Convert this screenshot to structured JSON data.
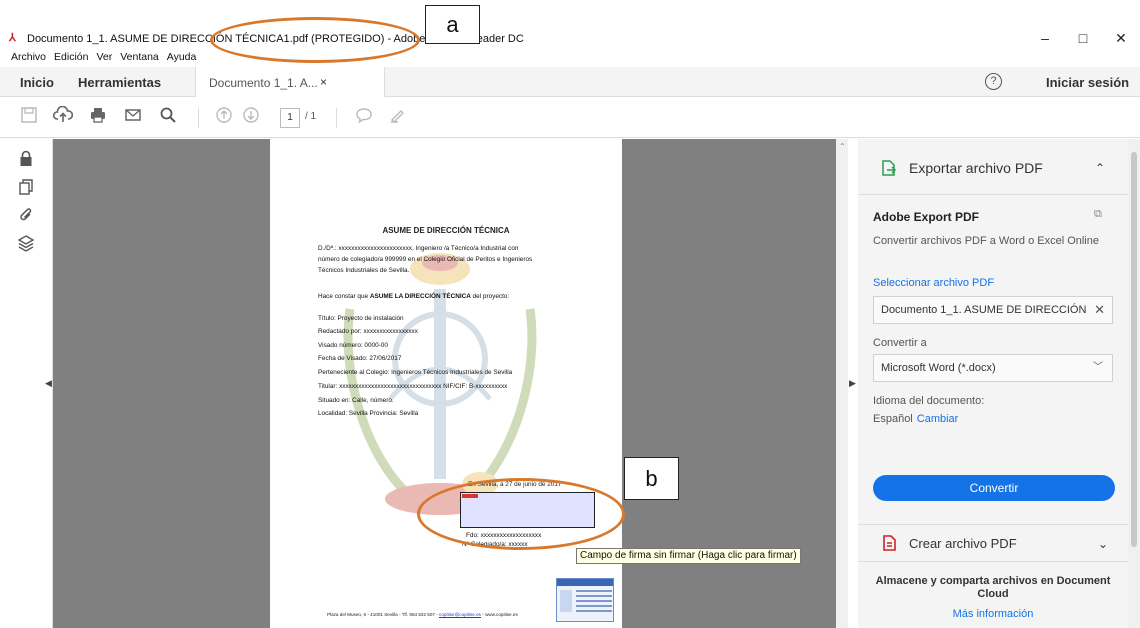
{
  "window": {
    "title": "Documento 1_1. ASUME DE DIRECCIÓN TÉCNICA1.pdf (PROTEGIDO) - Adobe Acrobat Reader DC",
    "controls": [
      "–",
      "□",
      "✕"
    ]
  },
  "menubar": [
    "Archivo",
    "Edición",
    "Ver",
    "Ventana",
    "Ayuda"
  ],
  "tabs": {
    "home": "Inicio",
    "tools": "Herramientas",
    "document": "Documento 1_1. A...",
    "close": "×",
    "help": "?",
    "login": "Iniciar sesión"
  },
  "toolbar": {
    "page_current": "1",
    "page_total": "/ 1"
  },
  "document": {
    "title": "ASUME DE DIRECCIÓN TÉCNICA",
    "paragraph1": [
      "D./Dª.: xxxxxxxxxxxxxxxxxxxxxxx, Ingeniero /a Técnico/a Industrial con",
      "número de colegiado/a 999999 en el Colegio Oficial de Peritos e Ingenieros",
      "Técnicos Industriales de Sevilla."
    ],
    "declaration_prefix": "Hace constar que ",
    "declaration_bold": "ASUME LA DIRECCIÓN TÉCNICA",
    "declaration_suffix": " del proyecto:",
    "fields": [
      "Título: Proyecto de instalación",
      "Redactado por: xxxxxxxxxxxxxxxxx",
      "Visado número: 0000-00",
      "Fecha de Visado: 27/06/2017",
      "Perteneciente al Colegio: Ingenieros Técnicos Industriales de Sevilla",
      "Titular: xxxxxxxxxxxxxxxxxxxxxxxxxxxxxxxx   NIF/CIF: B-xxxxxxxxxx",
      "Situado en: Calle, número.",
      "Localidad: Sevilla   Provincia: Sevilla"
    ],
    "sign_date": "En Sevilla, a 27 de junio de 2017",
    "signer": "Fdo: xxxxxxxxxxxxxxxxxxx",
    "member_no": "Nº Colegiado/a: xxxxxx",
    "footer_address": "Plaza del Museo, 6 - 41001 Sevilla - Tlf. 954 532 507 - ",
    "footer_email": "copitise@copitise.es",
    "footer_web": " - www.copitise.es"
  },
  "tooltip": "Campo de firma sin firmar (Haga clic para firmar)",
  "annotations": {
    "a": "a",
    "b": "b"
  },
  "right_panel": {
    "export_title": "Exportar archivo PDF",
    "adobe_export": "Adobe Export PDF",
    "description": "Convertir archivos PDF a Word o Excel Online",
    "select_file": "Seleccionar archivo PDF",
    "file_name": "Documento 1_1. ASUME DE DIRECCIÓN",
    "convert_to_label": "Convertir a",
    "convert_to_value": "Microsoft Word (*.docx)",
    "language_label": "Idioma del documento:",
    "language_value": "Español",
    "language_change": "Cambiar",
    "convert_button": "Convertir",
    "create_title": "Crear archivo PDF",
    "cloud_text": "Almacene y comparta archivos en Document Cloud",
    "more_info": "Más información"
  },
  "colors": {
    "accent": "#1473e6",
    "annotation_oval": "#d8782a",
    "viewer_bg": "#808080",
    "signature_field": "#dfe3ff"
  }
}
